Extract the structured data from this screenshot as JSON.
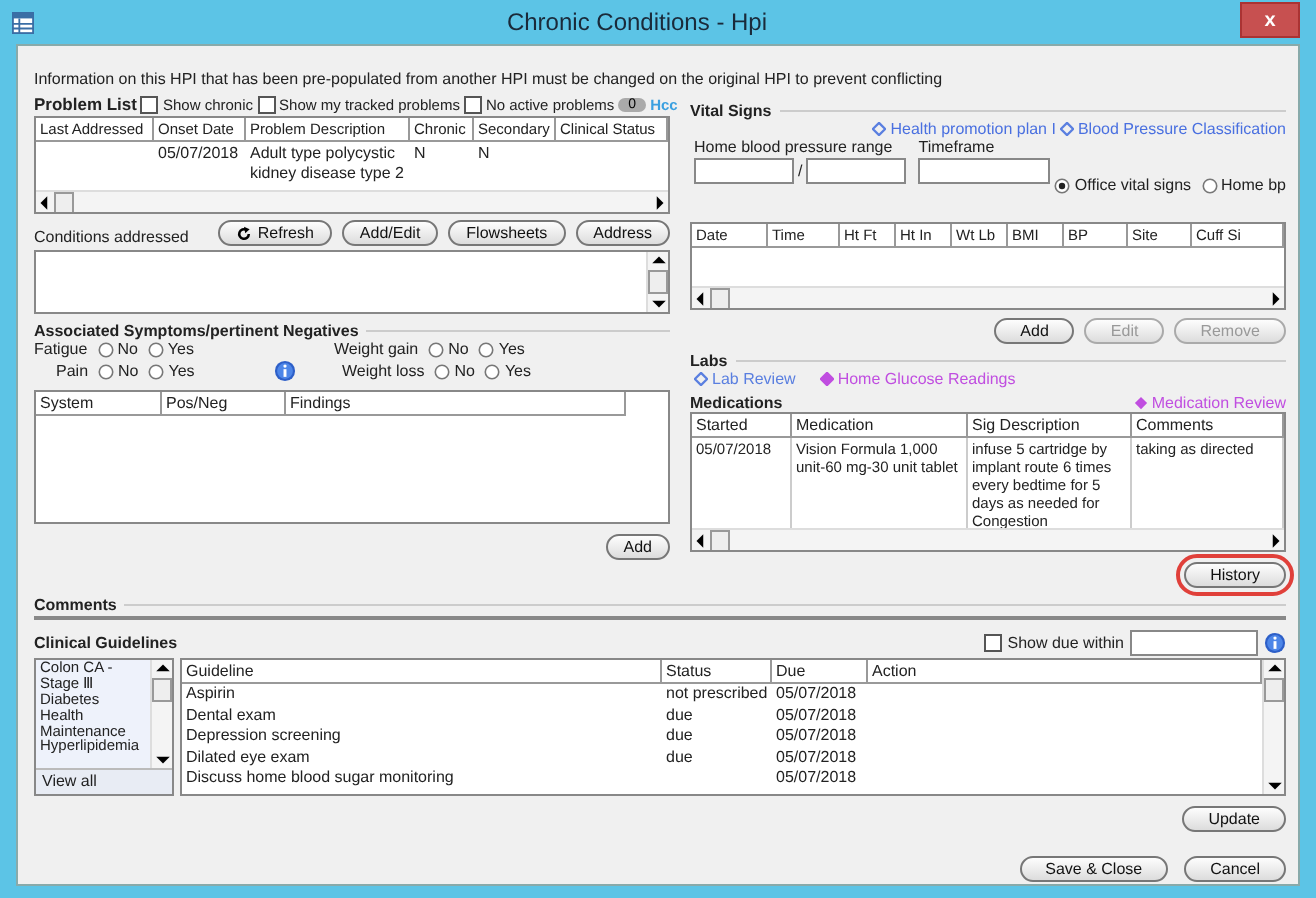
{
  "window": {
    "title": "Chronic Conditions - Hpi",
    "close": "x"
  },
  "notice": "Information on this HPI that has been pre-populated from another HPI must be changed on the original HPI to prevent conflicting",
  "problem_list": {
    "title": "Problem List",
    "options": [
      {
        "label": "Show chronic",
        "checked": false
      },
      {
        "label": "Show my tracked problems",
        "checked": false
      },
      {
        "label": "No active problems",
        "checked": false
      }
    ],
    "count": "0",
    "link": "Hcc",
    "columns": [
      "Last Addressed",
      "Onset Date",
      "Problem Description",
      "Chronic",
      "Secondary",
      "Clinical Status"
    ],
    "rows": [
      {
        "onset_date": "05/07/2018",
        "problem_description": "Adult type polycystic kidney disease type 2",
        "chronic": "N",
        "secondary": "N"
      }
    ],
    "buttons": [
      {
        "label": "Refresh",
        "kind": "refresh"
      },
      {
        "label": "Add/Edit",
        "kind": "plain"
      },
      {
        "label": "Flowsheets",
        "kind": "plain"
      },
      {
        "label": "Address",
        "kind": "plain"
      }
    ]
  },
  "conditions_addressed": {
    "label": "Conditions addressed"
  },
  "symptoms": {
    "title": "Associated Symptoms/pertinent Negatives",
    "items": [
      {
        "label": "Fatigue",
        "options": [
          {
            "label": "No",
            "selected": false
          },
          {
            "label": "Yes",
            "selected": false
          }
        ]
      },
      {
        "label": "Weight gain",
        "options": [
          {
            "label": "No",
            "selected": false
          },
          {
            "label": "Yes",
            "selected": false
          }
        ]
      },
      {
        "label": "Pain",
        "options": [
          {
            "label": "No",
            "selected": false
          },
          {
            "label": "Yes",
            "selected": false
          }
        ]
      },
      {
        "label": "Weight loss",
        "options": [
          {
            "label": "No",
            "selected": false
          },
          {
            "label": "Yes",
            "selected": false
          }
        ]
      }
    ],
    "columns": [
      "System",
      "Pos/Neg",
      "Findings"
    ],
    "add": "Add"
  },
  "vital_signs": {
    "title": "Vital Signs",
    "links": [
      "Health promotion plan I",
      "Blood Pressure Classification"
    ],
    "range_label": "Home blood pressure range",
    "separator": "/",
    "timeframe_label": "Timeframe",
    "modes": [
      {
        "label": "Office vital signs",
        "selected": true
      },
      {
        "label": "Home bp",
        "selected": false
      }
    ],
    "columns": [
      "Date",
      "Time",
      "Ht Ft",
      "Ht In",
      "Wt Lb",
      "BMI",
      "BP",
      "Site",
      "Cuff Si"
    ],
    "buttons": [
      {
        "label": "Add",
        "disabled": false
      },
      {
        "label": "Edit",
        "disabled": true
      },
      {
        "label": "Remove",
        "disabled": true
      }
    ]
  },
  "labs": {
    "title": "Labs",
    "links": [
      {
        "label": "Lab Review",
        "color": "#5a7fe0"
      },
      {
        "label": "Home Glucose Readings",
        "color": "#c04ee0"
      }
    ]
  },
  "medications": {
    "title": "Medications",
    "link": "Medication Review",
    "columns": [
      "Started",
      "Medication",
      "Sig Description",
      "Comments"
    ],
    "rows": [
      [
        "05/07/2018",
        "Vision Formula 1,000 unit-60 mg-30 unit tablet",
        "infuse 5 cartridge by implant route 6 times every bedtime for 5 days as needed for Congestion",
        "taking as directed"
      ]
    ],
    "history": {
      "label": "History",
      "highlighted": true
    }
  },
  "comments": {
    "label": "Comments"
  },
  "guidelines": {
    "title": "Clinical Guidelines",
    "show_due": {
      "label": "Show due within",
      "checked": false
    },
    "categories": [
      "Colon CA - Stage Ⅲ",
      "Diabetes",
      "Health Maintenance",
      "Hyperlipidemia"
    ],
    "view_all": "View all",
    "columns": [
      "Guideline",
      "Status",
      "Due",
      "Action"
    ],
    "rows": [
      {
        "guideline": "Aspirin",
        "status": "not prescribed",
        "due": "05/07/2018"
      },
      {
        "guideline": "Dental exam",
        "status": "due",
        "due": "05/07/2018"
      },
      {
        "guideline": "Depression screening",
        "status": "due",
        "due": "05/07/2018"
      },
      {
        "guideline": "Dilated eye exam",
        "status": "due",
        "due": "05/07/2018"
      },
      {
        "guideline": "Discuss home blood sugar monitoring",
        "due": "05/07/2018"
      }
    ],
    "update": "Update"
  },
  "footer_buttons": [
    "Save & Close",
    "Cancel"
  ]
}
